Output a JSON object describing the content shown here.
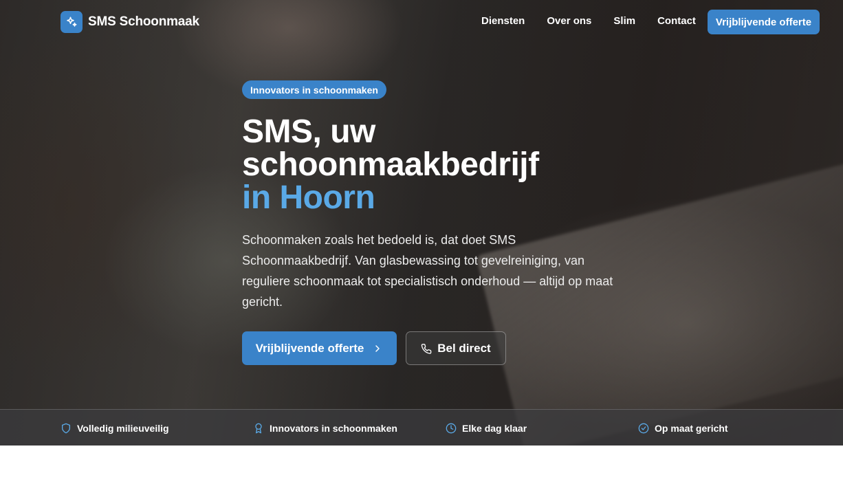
{
  "brand": {
    "name": "SMS Schoonmaak",
    "logo_icon": "sparkles-icon"
  },
  "nav": {
    "links": [
      "Diensten",
      "Over ons",
      "Slim",
      "Contact"
    ],
    "cta_label": "Vrijblijvende offerte"
  },
  "hero": {
    "badge": "Innovators in schoonmaken",
    "title_line1": "SMS, uw",
    "title_line2": "schoonmaakbedrijf",
    "title_accent": "in Hoorn",
    "lead": "Schoonmaken zoals het bedoeld is, dat doet SMS Schoonmaakbedrijf. Van glasbewassing tot gevelreiniging, van reguliere schoonmaak tot specialistisch onderhoud — altijd op maat gericht.",
    "primary_cta": "Vrijblijvende offerte",
    "secondary_cta": "Bel direct"
  },
  "features": [
    {
      "label": "Volledig milieuveilig",
      "icon": "shield-icon"
    },
    {
      "label": "Innovators in schoonmaken",
      "icon": "award-icon"
    },
    {
      "label": "Elke dag klaar",
      "icon": "clock-icon"
    },
    {
      "label": "Op maat gericht",
      "icon": "check-circle-icon"
    }
  ],
  "colors": {
    "accent": "#3a83c9",
    "accent_text": "#5aa9e6"
  }
}
